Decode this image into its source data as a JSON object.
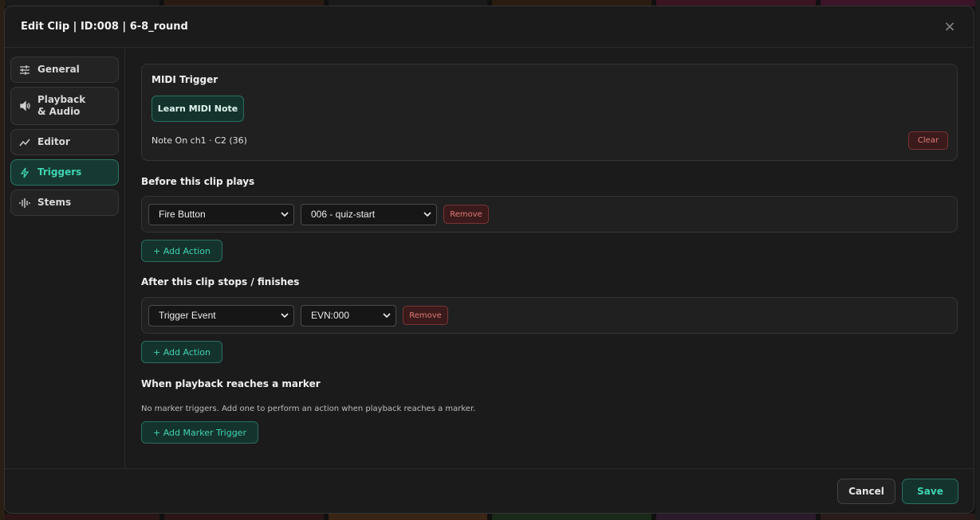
{
  "window": {
    "title": "Edit Clip | ID:008 | 6-8_round",
    "close_symbol": "×"
  },
  "sidebar": {
    "items": [
      {
        "label": "General",
        "icon": "sliders-icon",
        "active": false
      },
      {
        "label": "Playback & Audio",
        "icon": "speaker-icon",
        "active": false
      },
      {
        "label": "Editor",
        "icon": "line-chart-icon",
        "active": false
      },
      {
        "label": "Triggers",
        "icon": "lightning-icon",
        "active": true
      },
      {
        "label": "Stems",
        "icon": "waveform-icon",
        "active": false
      }
    ]
  },
  "midi": {
    "title": "MIDI Trigger",
    "learn_label": "Learn MIDI Note",
    "note_text": "Note On ch1 · C2 (36)",
    "clear_label": "Clear"
  },
  "before": {
    "title": "Before this clip plays",
    "action_type": "Fire Button",
    "target": "006 - quiz-start",
    "remove_label": "Remove",
    "add_label": "+ Add Action"
  },
  "after": {
    "title": "After this clip stops / finishes",
    "action_type": "Trigger Event",
    "target": "EVN:000",
    "remove_label": "Remove",
    "add_label": "+ Add Action"
  },
  "marker": {
    "title": "When playback reaches a marker",
    "hint": "No marker triggers. Add one to perform an action when playback reaches a marker.",
    "add_label": "+ Add Marker Trigger"
  },
  "footer": {
    "cancel_label": "Cancel",
    "save_label": "Save"
  },
  "colors": {
    "accent": "#3fd3b1",
    "accent_bg": "#15332d",
    "danger": "#e07a7a",
    "modal_bg": "#1b1b1b"
  }
}
